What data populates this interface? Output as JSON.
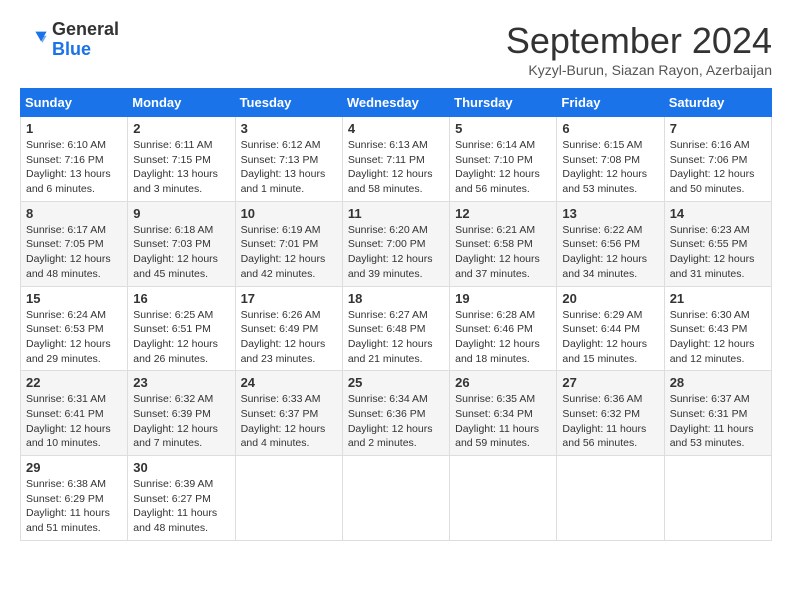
{
  "header": {
    "logo_general": "General",
    "logo_blue": "Blue",
    "month_title": "September 2024",
    "location": "Kyzyl-Burun, Siazan Rayon, Azerbaijan"
  },
  "weekdays": [
    "Sunday",
    "Monday",
    "Tuesday",
    "Wednesday",
    "Thursday",
    "Friday",
    "Saturday"
  ],
  "weeks": [
    [
      {
        "day": "1",
        "sunrise": "6:10 AM",
        "sunset": "7:16 PM",
        "daylight": "13 hours and 6 minutes."
      },
      {
        "day": "2",
        "sunrise": "6:11 AM",
        "sunset": "7:15 PM",
        "daylight": "13 hours and 3 minutes."
      },
      {
        "day": "3",
        "sunrise": "6:12 AM",
        "sunset": "7:13 PM",
        "daylight": "13 hours and 1 minute."
      },
      {
        "day": "4",
        "sunrise": "6:13 AM",
        "sunset": "7:11 PM",
        "daylight": "12 hours and 58 minutes."
      },
      {
        "day": "5",
        "sunrise": "6:14 AM",
        "sunset": "7:10 PM",
        "daylight": "12 hours and 56 minutes."
      },
      {
        "day": "6",
        "sunrise": "6:15 AM",
        "sunset": "7:08 PM",
        "daylight": "12 hours and 53 minutes."
      },
      {
        "day": "7",
        "sunrise": "6:16 AM",
        "sunset": "7:06 PM",
        "daylight": "12 hours and 50 minutes."
      }
    ],
    [
      {
        "day": "8",
        "sunrise": "6:17 AM",
        "sunset": "7:05 PM",
        "daylight": "12 hours and 48 minutes."
      },
      {
        "day": "9",
        "sunrise": "6:18 AM",
        "sunset": "7:03 PM",
        "daylight": "12 hours and 45 minutes."
      },
      {
        "day": "10",
        "sunrise": "6:19 AM",
        "sunset": "7:01 PM",
        "daylight": "12 hours and 42 minutes."
      },
      {
        "day": "11",
        "sunrise": "6:20 AM",
        "sunset": "7:00 PM",
        "daylight": "12 hours and 39 minutes."
      },
      {
        "day": "12",
        "sunrise": "6:21 AM",
        "sunset": "6:58 PM",
        "daylight": "12 hours and 37 minutes."
      },
      {
        "day": "13",
        "sunrise": "6:22 AM",
        "sunset": "6:56 PM",
        "daylight": "12 hours and 34 minutes."
      },
      {
        "day": "14",
        "sunrise": "6:23 AM",
        "sunset": "6:55 PM",
        "daylight": "12 hours and 31 minutes."
      }
    ],
    [
      {
        "day": "15",
        "sunrise": "6:24 AM",
        "sunset": "6:53 PM",
        "daylight": "12 hours and 29 minutes."
      },
      {
        "day": "16",
        "sunrise": "6:25 AM",
        "sunset": "6:51 PM",
        "daylight": "12 hours and 26 minutes."
      },
      {
        "day": "17",
        "sunrise": "6:26 AM",
        "sunset": "6:49 PM",
        "daylight": "12 hours and 23 minutes."
      },
      {
        "day": "18",
        "sunrise": "6:27 AM",
        "sunset": "6:48 PM",
        "daylight": "12 hours and 21 minutes."
      },
      {
        "day": "19",
        "sunrise": "6:28 AM",
        "sunset": "6:46 PM",
        "daylight": "12 hours and 18 minutes."
      },
      {
        "day": "20",
        "sunrise": "6:29 AM",
        "sunset": "6:44 PM",
        "daylight": "12 hours and 15 minutes."
      },
      {
        "day": "21",
        "sunrise": "6:30 AM",
        "sunset": "6:43 PM",
        "daylight": "12 hours and 12 minutes."
      }
    ],
    [
      {
        "day": "22",
        "sunrise": "6:31 AM",
        "sunset": "6:41 PM",
        "daylight": "12 hours and 10 minutes."
      },
      {
        "day": "23",
        "sunrise": "6:32 AM",
        "sunset": "6:39 PM",
        "daylight": "12 hours and 7 minutes."
      },
      {
        "day": "24",
        "sunrise": "6:33 AM",
        "sunset": "6:37 PM",
        "daylight": "12 hours and 4 minutes."
      },
      {
        "day": "25",
        "sunrise": "6:34 AM",
        "sunset": "6:36 PM",
        "daylight": "12 hours and 2 minutes."
      },
      {
        "day": "26",
        "sunrise": "6:35 AM",
        "sunset": "6:34 PM",
        "daylight": "11 hours and 59 minutes."
      },
      {
        "day": "27",
        "sunrise": "6:36 AM",
        "sunset": "6:32 PM",
        "daylight": "11 hours and 56 minutes."
      },
      {
        "day": "28",
        "sunrise": "6:37 AM",
        "sunset": "6:31 PM",
        "daylight": "11 hours and 53 minutes."
      }
    ],
    [
      {
        "day": "29",
        "sunrise": "6:38 AM",
        "sunset": "6:29 PM",
        "daylight": "11 hours and 51 minutes."
      },
      {
        "day": "30",
        "sunrise": "6:39 AM",
        "sunset": "6:27 PM",
        "daylight": "11 hours and 48 minutes."
      },
      null,
      null,
      null,
      null,
      null
    ]
  ]
}
